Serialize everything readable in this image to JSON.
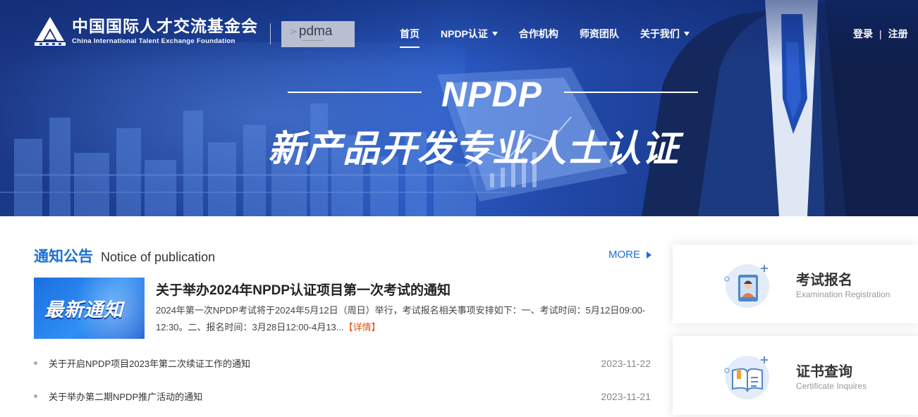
{
  "brand": {
    "name_cn": "中国国际人才交流基金会",
    "name_en": "China International Talent Exchange Foundation",
    "partner_logo": "pdma"
  },
  "nav": {
    "items": [
      {
        "label": "首页",
        "active": true,
        "dropdown": false
      },
      {
        "label": "NPDP认证",
        "active": false,
        "dropdown": true
      },
      {
        "label": "合作机构",
        "active": false,
        "dropdown": false
      },
      {
        "label": "师资团队",
        "active": false,
        "dropdown": false
      },
      {
        "label": "关于我们",
        "active": false,
        "dropdown": true
      }
    ],
    "login": "登录",
    "divider": "|",
    "register": "注册"
  },
  "hero": {
    "heading": "NPDP",
    "slogan": "新产品开发专业人士认证"
  },
  "notices": {
    "title_cn": "通知公告",
    "title_en": "Notice of publication",
    "more": "MORE",
    "featured": {
      "image_text": "最新通知",
      "title": "关于举办2024年NPDP认证项目第一次考试的通知",
      "summary": "2024年第一次NPDP考试将于2024年5月12日（周日）举行，考试报名相关事项安排如下：一、考试时间：5月12日09:00-12:30。二、报名时间：3月28日12:00-4月13...",
      "detail_link": "【详情】"
    },
    "list": [
      {
        "title": "关于开启NPDP项目2023年第二次续证工作的通知",
        "date": "2023-11-22"
      },
      {
        "title": "关于举办第二期NPDP推广活动的通知",
        "date": "2023-11-21"
      }
    ]
  },
  "services": [
    {
      "title": "考试报名",
      "subtitle": "Examination Registration",
      "icon": "registration-icon"
    },
    {
      "title": "证书查询",
      "subtitle": "Certificate Inquires",
      "icon": "certificate-icon"
    }
  ],
  "colors": {
    "accent": "#1a6fd4",
    "detail_link": "#e2520c",
    "hero_blue": "#1e45a0"
  }
}
